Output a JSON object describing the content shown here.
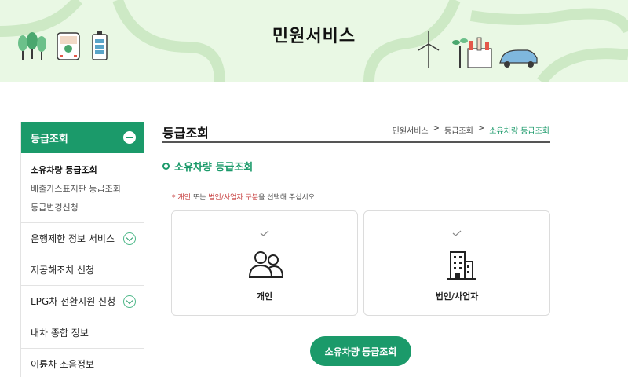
{
  "banner": {
    "title": "민원서비스"
  },
  "sidebar": {
    "header": "등급조회",
    "sub_items": [
      "소유차량 등급조회",
      "배출가스표지판 등급조회",
      "등급변경신청"
    ],
    "items": [
      {
        "label": "운행제한 정보 서비스",
        "expandable": true
      },
      {
        "label": "저공해조치 신청",
        "expandable": false
      },
      {
        "label": "LPG차 전환지원 신청",
        "expandable": true
      },
      {
        "label": "내차 종합 정보",
        "expandable": false
      },
      {
        "label": "이륜차 소음정보",
        "expandable": false
      }
    ]
  },
  "main": {
    "title": "등급조회",
    "breadcrumb": [
      "민원서비스",
      "등급조회",
      "소유차량 등급조회"
    ],
    "section_title": "소유차량 등급조회",
    "notice": {
      "prefix": "* ",
      "part1": "개인",
      "part2": " 또는 ",
      "part3": "법인/사업자 구분",
      "part4": "을 선택해 주십시오."
    },
    "cards": [
      {
        "label": "개인",
        "icon": "people-icon"
      },
      {
        "label": "법인/사업자",
        "icon": "building-icon"
      }
    ],
    "submit_label": "소유차량 등급조회"
  },
  "colors": {
    "accent": "#1b9a6a",
    "banner_bg": "#e9f8e4",
    "notice_red": "#c63c3c"
  }
}
